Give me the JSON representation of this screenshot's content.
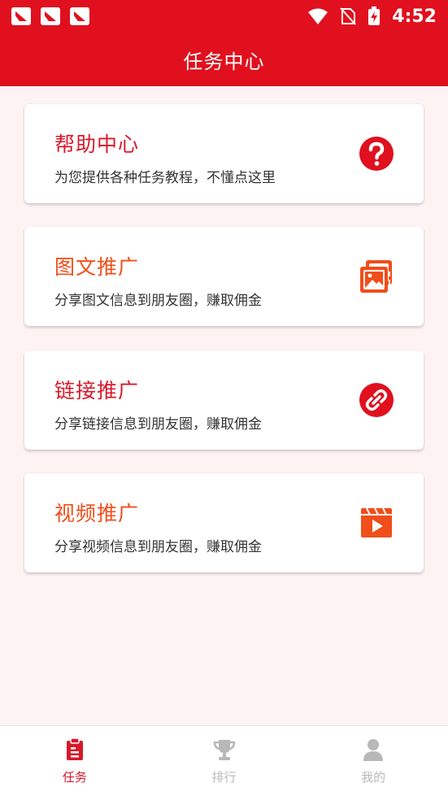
{
  "status_bar": {
    "time": "4:52"
  },
  "header": {
    "title": "任务中心"
  },
  "cards": [
    {
      "title": "帮助中心",
      "subtitle": "为您提供各种任务教程，不懂点这里",
      "title_color": "#d7192a",
      "icon": "help-circle-icon"
    },
    {
      "title": "图文推广",
      "subtitle": "分享图文信息到朋友圈，赚取佣金",
      "title_color": "#f04e1a",
      "icon": "image-gallery-icon"
    },
    {
      "title": "链接推广",
      "subtitle": "分享链接信息到朋友圈，赚取佣金",
      "title_color": "#d7192a",
      "icon": "link-icon"
    },
    {
      "title": "视频推广",
      "subtitle": "分享视频信息到朋友圈，赚取佣金",
      "title_color": "#f04e1a",
      "icon": "video-icon"
    }
  ],
  "tabbar": {
    "tabs": [
      {
        "label": "任务",
        "active": true,
        "icon": "clipboard-icon"
      },
      {
        "label": "排行",
        "active": false,
        "icon": "trophy-icon"
      },
      {
        "label": "我的",
        "active": false,
        "icon": "user-icon"
      }
    ]
  },
  "colors": {
    "brand_red": "#e0101e",
    "active_tab": "#d7192a",
    "inactive_tab": "#b8b8b8"
  }
}
